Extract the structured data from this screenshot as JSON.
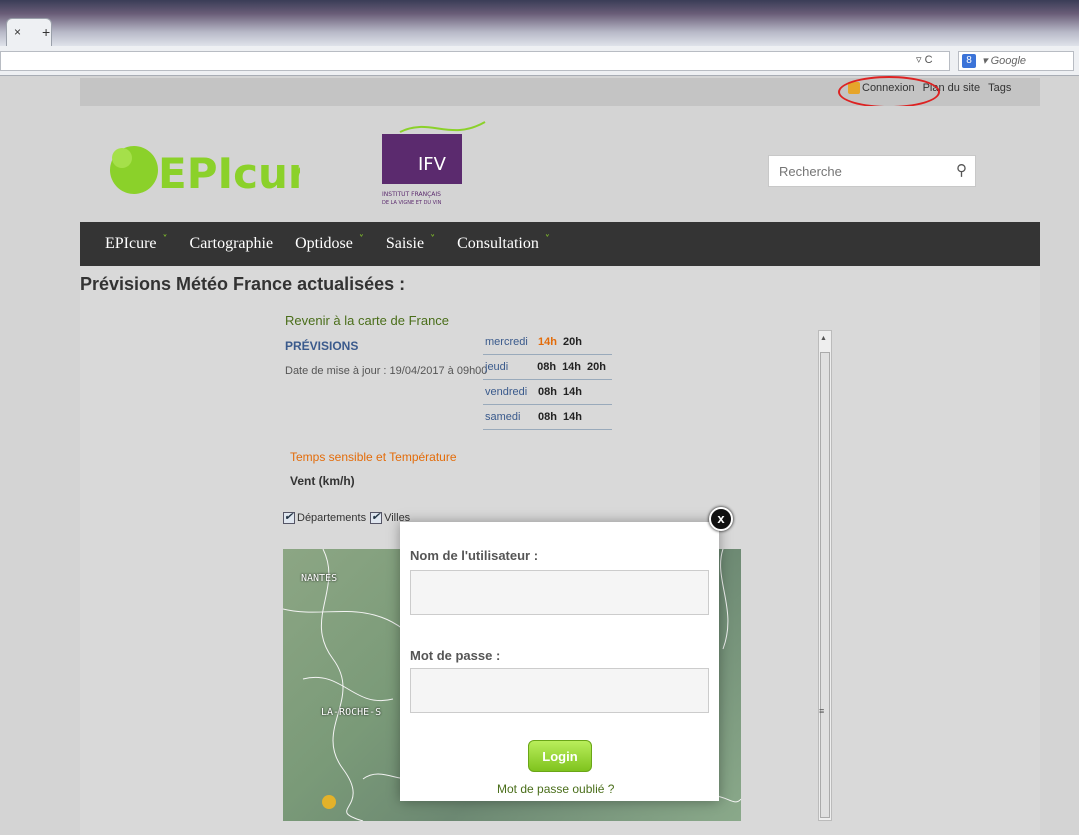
{
  "browser": {
    "tab_close": "×",
    "tab_new": "+",
    "search_engine_placeholder": "Google",
    "search_badge": "8"
  },
  "toplinks": {
    "connexion": "Connexion",
    "plan": "Plan du site",
    "tags": "Tags"
  },
  "logo": {
    "epicure": "EPIcure",
    "ifv": "IFV",
    "ifv_sub1": "INSTITUT FRANÇAIS",
    "ifv_sub2": "DE LA VIGNE ET DU VIN"
  },
  "search": {
    "placeholder": "Recherche"
  },
  "nav": {
    "items": [
      {
        "label": "EPIcure",
        "chevron": true
      },
      {
        "label": "Cartographie",
        "chevron": false
      },
      {
        "label": "Optidose",
        "chevron": true
      },
      {
        "label": "Saisie",
        "chevron": true
      },
      {
        "label": "Consultation",
        "chevron": true
      }
    ],
    "chevron_glyph": "˅"
  },
  "page": {
    "title": "Prévisions Météo France actualisées :",
    "back_link": "Revenir à la carte de France",
    "previsions": "PRÉVISIONS",
    "update": "Date de mise à jour : 19/04/2017 à 09h00",
    "temps": "Temps sensible et Température",
    "vent": "Vent (km/h)",
    "check_departements": "Départements",
    "check_villes": "Villes"
  },
  "days": [
    {
      "name": "mercredi",
      "hours": [
        "14h",
        "20h"
      ],
      "highlight": 0
    },
    {
      "name": "jeudi",
      "hours": [
        "08h",
        "14h",
        "20h"
      ],
      "highlight": -1
    },
    {
      "name": "vendredi",
      "hours": [
        "08h",
        "14h"
      ],
      "highlight": -1
    },
    {
      "name": "samedi",
      "hours": [
        "08h",
        "14h"
      ],
      "highlight": -1
    }
  ],
  "map": {
    "cities": [
      "NANTES",
      "LA-ROCHE-S"
    ]
  },
  "modal": {
    "username_label": "Nom de l'utilisateur :",
    "password_label": "Mot de passe :",
    "login": "Login",
    "forgot": "Mot de passe oublié ?",
    "close": "x"
  },
  "colors": {
    "accent_green": "#8bd12a",
    "nav_bg": "#343434",
    "highlight_orange": "#e36c0a",
    "annotation_red": "#dd2222"
  }
}
